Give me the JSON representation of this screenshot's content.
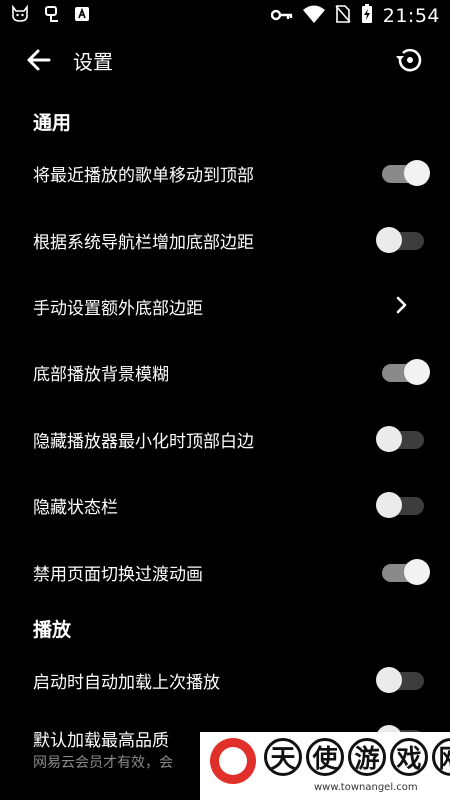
{
  "status_bar": {
    "time": "21:54"
  },
  "header": {
    "title": "设置"
  },
  "sections": [
    {
      "title": "通用"
    },
    {
      "title": "播放"
    }
  ],
  "settings": [
    {
      "label": "将最近播放的歌单移动到顶部",
      "state": "on"
    },
    {
      "label": "根据系统导航栏增加底部边距",
      "state": "off"
    },
    {
      "label": "手动设置额外底部边距",
      "state": "chevron"
    },
    {
      "label": "底部播放背景模糊",
      "state": "on"
    },
    {
      "label": "隐藏播放器最小化时顶部白边",
      "state": "off"
    },
    {
      "label": "隐藏状态栏",
      "state": "off"
    },
    {
      "label": "禁用页面切换过渡动画",
      "state": "on"
    },
    {
      "label": "启动时自动加载上次播放",
      "state": "off"
    },
    {
      "label": "默认加载最高品质",
      "sublabel": "网易云会员才有效，会",
      "state": "off"
    }
  ],
  "watermark": {
    "chars": [
      "天",
      "使",
      "游",
      "戏",
      "网"
    ],
    "url": "www.townangel.com"
  },
  "colors": {
    "background": "#000000",
    "toggle_on_track": "#8a8a8a",
    "toggle_off_track": "#3d3d3d",
    "watermark_red": "#e12f2a"
  }
}
